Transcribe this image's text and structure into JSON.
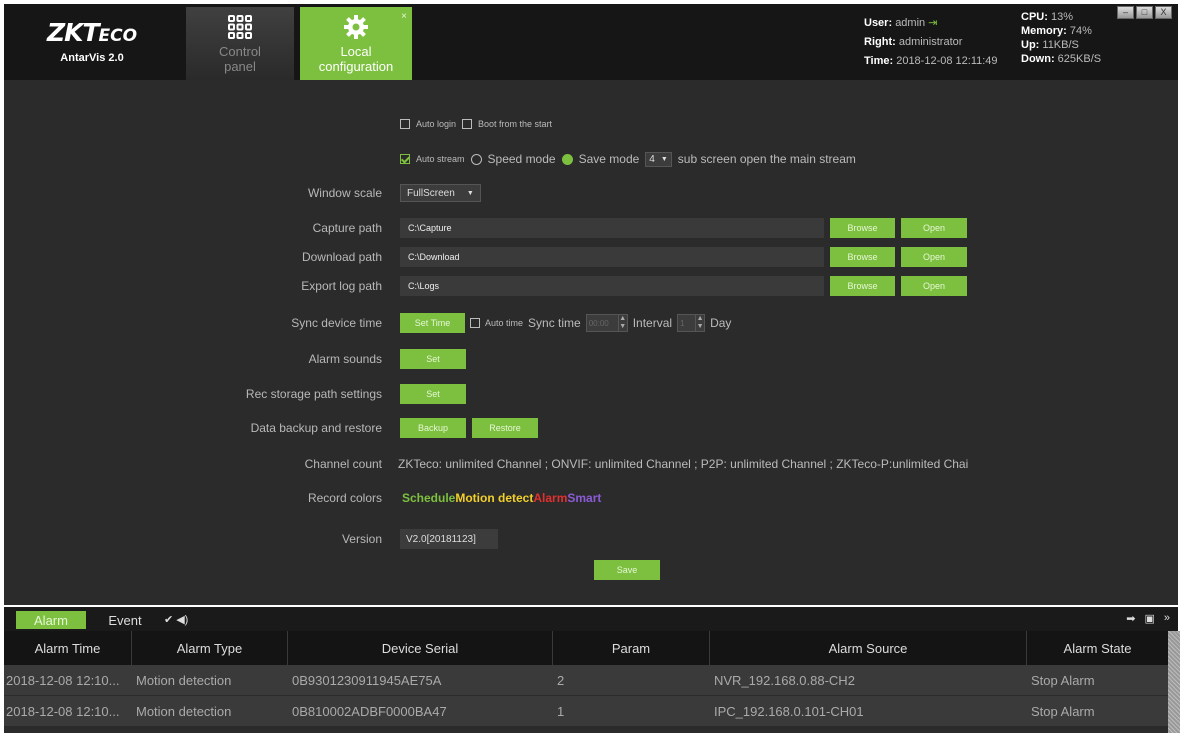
{
  "header": {
    "logo": {
      "main": "ZKT",
      "eco": "ECO",
      "sub": "AntarVis 2.0"
    },
    "tabs": [
      {
        "line1": "Control",
        "line2": "panel"
      },
      {
        "line1": "Local",
        "line2": "configuration",
        "close": "×"
      }
    ],
    "user": {
      "user_label": "User:",
      "user_value": "admin",
      "right_label": "Right:",
      "right_value": "administrator",
      "time_label": "Time:",
      "time_value": "2018-12-08 12:11:49"
    },
    "sys": {
      "cpu_label": "CPU:",
      "cpu_value": "13%",
      "memory_label": "Memory:",
      "memory_value": "74%",
      "up_label": "Up:",
      "up_value": "11KB/S",
      "down_label": "Down:",
      "down_value": "625KB/S"
    },
    "window_buttons": [
      "–",
      "□",
      "X"
    ]
  },
  "config": {
    "auto_login": "Auto login",
    "boot_start": "Boot from the start",
    "auto_stream": "Auto stream",
    "speed_mode": "Speed mode",
    "save_mode": "Save mode",
    "sub_screen_count": "4",
    "sub_screen_text": "sub screen open the main stream",
    "window_scale_label": "Window scale",
    "window_scale_value": "FullScreen",
    "capture_label": "Capture path",
    "capture_path": "C:\\Capture",
    "download_label": "Download path",
    "download_path": "C:\\Download",
    "export_label": "Export log path",
    "export_path": "C:\\Logs",
    "browse": "Browse",
    "open": "Open",
    "sync_label": "Sync device time",
    "set_time": "Set Time",
    "auto_time": "Auto time",
    "sync_time_label": "Sync time",
    "sync_time_value": "00:00",
    "interval_label": "Interval",
    "interval_value": "1",
    "day_label": "Day",
    "alarm_sounds_label": "Alarm sounds",
    "rec_storage_label": "Rec storage path settings",
    "set": "Set",
    "backup_label": "Data backup and restore",
    "backup": "Backup",
    "restore": "Restore",
    "channel_count_label": "Channel count",
    "channel_count_value": "ZKTeco: unlimited Channel ;  ONVIF: unlimited Channel ;  P2P: unlimited Channel ;  ZKTeco-P:unlimited Chai",
    "record_colors_label": "Record colors",
    "record_colors": [
      {
        "text": "Schedule",
        "color": "#7dc03f"
      },
      {
        "text": "Motion detect",
        "color": "#f2d02a"
      },
      {
        "text": "Alarm",
        "color": "#e03030"
      },
      {
        "text": "Smart",
        "color": "#8b5bd6"
      }
    ],
    "version_label": "Version",
    "version_value": "V2.0[20181123]",
    "save": "Save"
  },
  "alarm_panel": {
    "tabs": [
      "Alarm",
      "Event"
    ],
    "icons": [
      "broom-icon",
      "speaker-icon",
      "pin-icon",
      "restore-icon",
      "collapse-icon"
    ],
    "columns": [
      "Alarm Time",
      "Alarm Type",
      "Device Serial",
      "Param",
      "Alarm Source",
      "Alarm State"
    ],
    "rows": [
      [
        "2018-12-08 12:10...",
        "Motion detection",
        "0B9301230911945AE75A",
        "2",
        "NVR_192.168.0.88-CH2",
        "Stop Alarm"
      ],
      [
        "2018-12-08 12:10...",
        "Motion detection",
        "0B810002ADBF0000BA47",
        "1",
        "IPC_192.168.0.101-CH01",
        "Stop Alarm"
      ]
    ]
  }
}
